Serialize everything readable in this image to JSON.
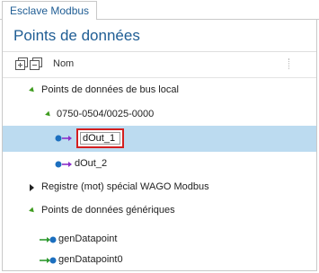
{
  "tab": {
    "label": "Esclave Modbus"
  },
  "title": "Points de données",
  "header": {
    "name_column": "Nom"
  },
  "tree": {
    "local_bus": {
      "label": "Points de données de bus local"
    },
    "module": {
      "label": "0750-0504/0025-0000"
    },
    "dout1": {
      "value": "dOut_1"
    },
    "dout2": {
      "label": "dOut_2"
    },
    "wago_register": {
      "label": "Registre (mot) spécial WAGO  Modbus"
    },
    "generic": {
      "label": "Points de données génériques"
    },
    "gen1": {
      "label": "genDatapoint"
    },
    "gen2": {
      "label": "genDatapoint0"
    }
  },
  "colors": {
    "accent": "#1f5d94",
    "selection": "#bcdbf0",
    "expand_arrow": "#3e9b1e",
    "edit_outline": "#d31f1f",
    "output_arrow": "#8b2fc9",
    "input_arrow": "#2f9a2f",
    "dot": "#1c6fbf"
  }
}
